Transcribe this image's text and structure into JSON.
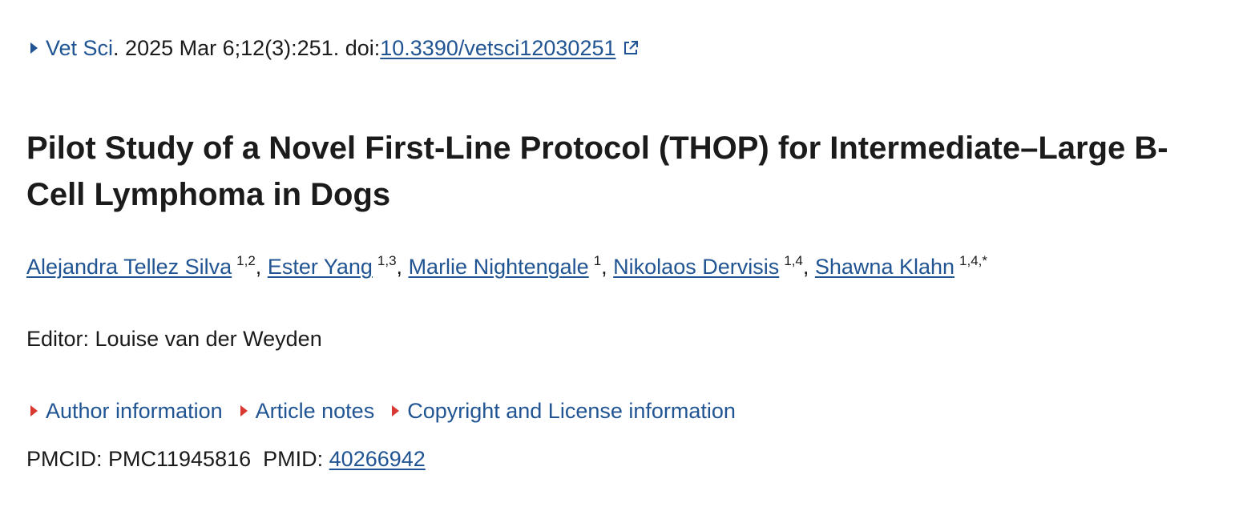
{
  "citation": {
    "journal": "Vet Sci",
    "details": ". 2025 Mar 6;12(3):251. doi: ",
    "doi": "10.3390/vetsci12030251"
  },
  "title": "Pilot Study of a Novel First-Line Protocol (THOP) for Intermediate–Large B-Cell Lymphoma in Dogs",
  "authors": [
    {
      "name": "Alejandra Tellez Silva",
      "aff": "1,2"
    },
    {
      "name": "Ester Yang",
      "aff": "1,3"
    },
    {
      "name": "Marlie Nightengale",
      "aff": "1"
    },
    {
      "name": "Nikolaos Dervisis",
      "aff": "1,4"
    },
    {
      "name": "Shawna Klahn",
      "aff": "1,4,*"
    }
  ],
  "separator": ", ",
  "editor": "Editor: Louise van der Weyden",
  "accordions": [
    "Author information",
    "Article notes",
    "Copyright and License information"
  ],
  "ids": {
    "pmcid_label": "PMCID: PMC11945816",
    "pmid_label": "PMID: ",
    "pmid": "40266942"
  },
  "colors": {
    "link": "#205493",
    "accent_red": "#d83933",
    "text": "#1b1b1b"
  },
  "icons": {
    "citation_toggle": "triangle-right-icon",
    "doi_external": "external-link-icon",
    "accordion_toggle": "triangle-right-icon"
  }
}
